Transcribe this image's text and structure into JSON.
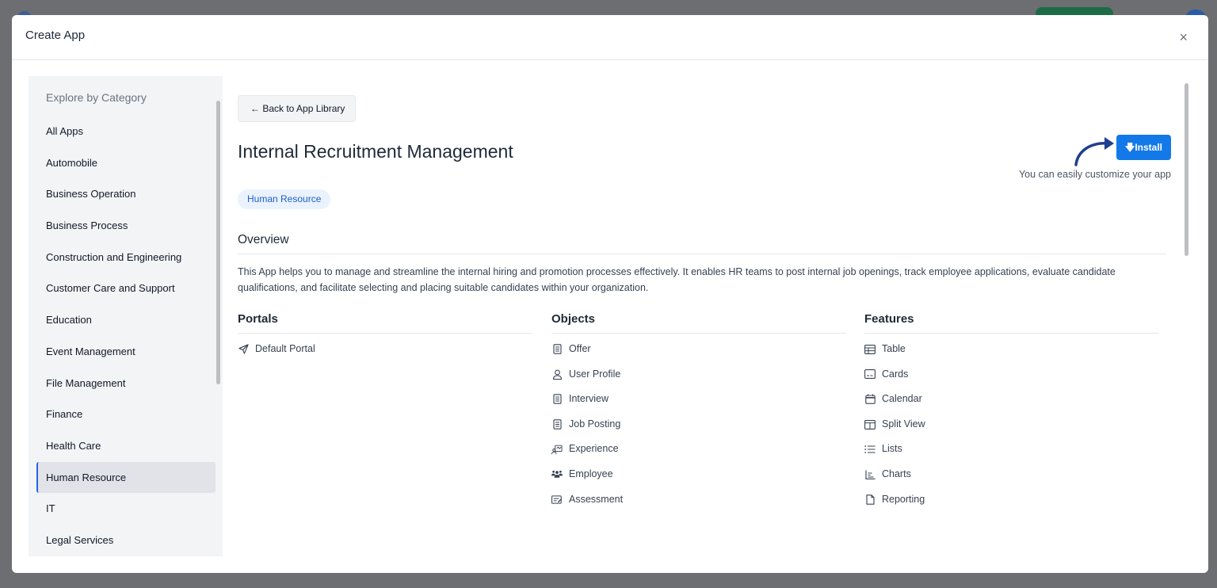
{
  "modal": {
    "title": "Create App",
    "close_label": "×"
  },
  "sidebar": {
    "heading": "Explore by Category",
    "items": [
      {
        "label": "All Apps"
      },
      {
        "label": "Automobile"
      },
      {
        "label": "Business Operation"
      },
      {
        "label": "Business Process"
      },
      {
        "label": "Construction and Engineering"
      },
      {
        "label": "Customer Care and Support"
      },
      {
        "label": "Education"
      },
      {
        "label": "Event Management"
      },
      {
        "label": "File Management"
      },
      {
        "label": "Finance"
      },
      {
        "label": "Health Care"
      },
      {
        "label": "Human Resource",
        "active": true
      },
      {
        "label": "IT"
      },
      {
        "label": "Legal Services"
      }
    ]
  },
  "main": {
    "back_label": "← Back to App Library",
    "app_title": "Internal Recruitment Management",
    "install_label": "Install",
    "customize_text": "You can easily customize your app",
    "tag": "Human Resource",
    "overview_heading": "Overview",
    "overview_text": "This App helps you to manage and streamline the internal hiring and promotion processes effectively. It enables HR teams to post internal job openings, track employee applications, evaluate candidate qualifications, and facilitate selecting and placing suitable candidates within your organization.",
    "portals": {
      "heading": "Portals",
      "items": [
        {
          "label": "Default Portal",
          "icon": "send-icon"
        }
      ]
    },
    "objects": {
      "heading": "Objects",
      "items": [
        {
          "label": "Offer",
          "icon": "document-icon"
        },
        {
          "label": "User Profile",
          "icon": "user-icon"
        },
        {
          "label": "Interview",
          "icon": "document-icon"
        },
        {
          "label": "Job Posting",
          "icon": "document-icon"
        },
        {
          "label": "Experience",
          "icon": "experience-icon"
        },
        {
          "label": "Employee",
          "icon": "group-icon"
        },
        {
          "label": "Assessment",
          "icon": "assessment-icon"
        }
      ]
    },
    "features": {
      "heading": "Features",
      "items": [
        {
          "label": "Table",
          "icon": "table-icon"
        },
        {
          "label": "Cards",
          "icon": "cards-icon"
        },
        {
          "label": "Calendar",
          "icon": "calendar-icon"
        },
        {
          "label": "Split View",
          "icon": "split-view-icon"
        },
        {
          "label": "Lists",
          "icon": "list-icon"
        },
        {
          "label": "Charts",
          "icon": "chart-icon"
        },
        {
          "label": "Reporting",
          "icon": "file-icon"
        }
      ]
    }
  },
  "colors": {
    "accent": "#1479e8",
    "tag_bg": "#eaf2fd",
    "tag_text": "#1d5fcc",
    "annotation_arrow": "#1f3f8f"
  }
}
